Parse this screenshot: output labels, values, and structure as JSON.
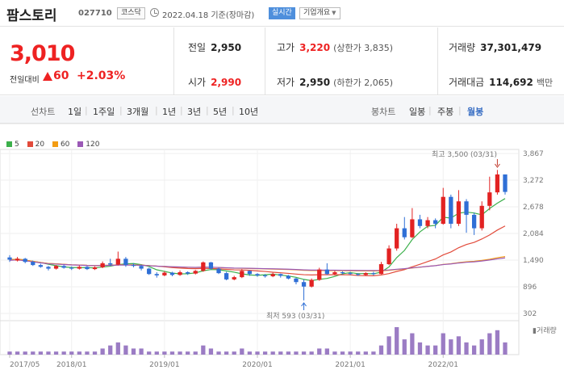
{
  "header": {
    "name": "팜스토리",
    "code": "027710",
    "market": "코스닥",
    "date": "2022.04.18 기준(장마감)",
    "realtime": "실시간",
    "corp_info": "기업개요"
  },
  "summary": {
    "price": "3,010",
    "change_label": "전일대비",
    "change": "60",
    "change_pct": "+2.03%",
    "prev_label": "전일",
    "prev": "2,950",
    "high_label": "고가",
    "high": "3,220",
    "upper_limit": "(상한가 3,835)",
    "volume_label": "거래량",
    "volume": "37,301,479",
    "open_label": "시가",
    "open": "2,990",
    "low_label": "저가",
    "low": "2,950",
    "lower_limit": "(하한가 2,065)",
    "amount_label": "거래대금",
    "amount": "114,692",
    "amount_unit": "백만"
  },
  "periods": {
    "line_label": "선차트",
    "line_items": [
      "1일",
      "1주일",
      "3개월",
      "1년",
      "3년",
      "5년",
      "10년"
    ],
    "candle_label": "봉차트",
    "candle_items": [
      "일봉",
      "주봉",
      "월봉"
    ],
    "active": "월봉"
  },
  "colors": {
    "up": "#e22222",
    "down": "#2f6fd6",
    "ma5": "#3cb04b",
    "ma20": "#e24b3b",
    "ma60": "#f39c12",
    "ma120": "#9b59b6"
  },
  "chart_data": {
    "type": "candlestick",
    "legend": [
      {
        "name": "5",
        "color": "#3cb04b"
      },
      {
        "name": "20",
        "color": "#e24b3b"
      },
      {
        "name": "60",
        "color": "#f39c12"
      },
      {
        "name": "120",
        "color": "#9b59b6"
      }
    ],
    "y_ticks": [
      "3,867",
      "3,272",
      "2,678",
      "2,084",
      "1,490",
      "896",
      "302"
    ],
    "ylim": [
      302,
      3867
    ],
    "x_ticks": [
      "2017/05",
      "2018/01",
      "2019/01",
      "2020/01",
      "2021/01",
      "2022/01"
    ],
    "volume_label": "거래량",
    "annotations": {
      "high": "최고 3,500 (03/31)",
      "low": "최저 593 (03/31)"
    },
    "candles": [
      [
        1550,
        1500,
        1600,
        1450,
        1
      ],
      [
        1480,
        1520,
        1560,
        1460,
        1
      ],
      [
        1520,
        1450,
        1540,
        1420,
        1
      ],
      [
        1450,
        1380,
        1480,
        1360,
        1
      ],
      [
        1380,
        1340,
        1410,
        1320,
        1
      ],
      [
        1340,
        1300,
        1360,
        1260,
        1
      ],
      [
        1300,
        1360,
        1380,
        1280,
        1
      ],
      [
        1360,
        1320,
        1390,
        1300,
        1
      ],
      [
        1320,
        1300,
        1350,
        1270,
        1
      ],
      [
        1300,
        1340,
        1370,
        1280,
        1
      ],
      [
        1340,
        1290,
        1360,
        1270,
        1
      ],
      [
        1290,
        1330,
        1350,
        1270,
        1
      ],
      [
        1330,
        1420,
        1460,
        1310,
        2
      ],
      [
        1420,
        1390,
        1520,
        1360,
        3
      ],
      [
        1390,
        1520,
        1680,
        1370,
        4
      ],
      [
        1520,
        1380,
        1560,
        1340,
        3
      ],
      [
        1380,
        1360,
        1420,
        1330,
        2
      ],
      [
        1360,
        1300,
        1380,
        1260,
        2
      ],
      [
        1300,
        1180,
        1320,
        1160,
        1
      ],
      [
        1180,
        1150,
        1220,
        1100,
        1
      ],
      [
        1150,
        1210,
        1240,
        1130,
        1
      ],
      [
        1210,
        1160,
        1230,
        1130,
        1
      ],
      [
        1160,
        1220,
        1260,
        1140,
        1
      ],
      [
        1220,
        1190,
        1240,
        1160,
        1
      ],
      [
        1190,
        1250,
        1270,
        1170,
        1
      ],
      [
        1250,
        1440,
        1460,
        1230,
        3
      ],
      [
        1440,
        1300,
        1450,
        1280,
        2
      ],
      [
        1300,
        1200,
        1320,
        1180,
        1
      ],
      [
        1200,
        1060,
        1230,
        1040,
        1
      ],
      [
        1060,
        1110,
        1140,
        1040,
        1
      ],
      [
        1110,
        1250,
        1290,
        1090,
        2
      ],
      [
        1250,
        1180,
        1260,
        1140,
        1
      ],
      [
        1180,
        1150,
        1200,
        1120,
        1
      ],
      [
        1150,
        1130,
        1180,
        1100,
        1
      ],
      [
        1130,
        1180,
        1210,
        1110,
        1
      ],
      [
        1180,
        1140,
        1190,
        1100,
        1
      ],
      [
        1140,
        1080,
        1160,
        1060,
        1
      ],
      [
        1080,
        1000,
        1100,
        950,
        1
      ],
      [
        1000,
        900,
        1060,
        593,
        1
      ],
      [
        900,
        1050,
        1080,
        880,
        1
      ],
      [
        1050,
        1280,
        1320,
        1030,
        2
      ],
      [
        1280,
        1180,
        1420,
        1160,
        2
      ],
      [
        1180,
        1220,
        1250,
        1150,
        1
      ],
      [
        1220,
        1200,
        1240,
        1170,
        1
      ],
      [
        1200,
        1180,
        1230,
        1160,
        1
      ],
      [
        1180,
        1160,
        1200,
        1140,
        1
      ],
      [
        1160,
        1200,
        1220,
        1140,
        1
      ],
      [
        1200,
        1180,
        1230,
        1150,
        1
      ],
      [
        1180,
        1400,
        1450,
        1170,
        3
      ],
      [
        1400,
        1750,
        1820,
        1380,
        6
      ],
      [
        1750,
        2200,
        2300,
        1700,
        9
      ],
      [
        2200,
        2000,
        2450,
        1950,
        5
      ],
      [
        2000,
        2400,
        2650,
        1980,
        7
      ],
      [
        2400,
        2250,
        2500,
        2200,
        4
      ],
      [
        2250,
        2380,
        2450,
        2200,
        3
      ],
      [
        2380,
        2300,
        2420,
        2200,
        3
      ],
      [
        2300,
        2900,
        3100,
        2280,
        7
      ],
      [
        2900,
        2300,
        2950,
        2200,
        5
      ],
      [
        2300,
        2800,
        3050,
        2250,
        6
      ],
      [
        2800,
        2500,
        2850,
        2100,
        4
      ],
      [
        2500,
        2200,
        2550,
        2050,
        3
      ],
      [
        2200,
        2700,
        2800,
        2150,
        5
      ],
      [
        2700,
        3000,
        3350,
        2600,
        7
      ],
      [
        3000,
        3400,
        3500,
        2950,
        8
      ],
      [
        3400,
        3010,
        3220,
        2950,
        4
      ]
    ]
  }
}
